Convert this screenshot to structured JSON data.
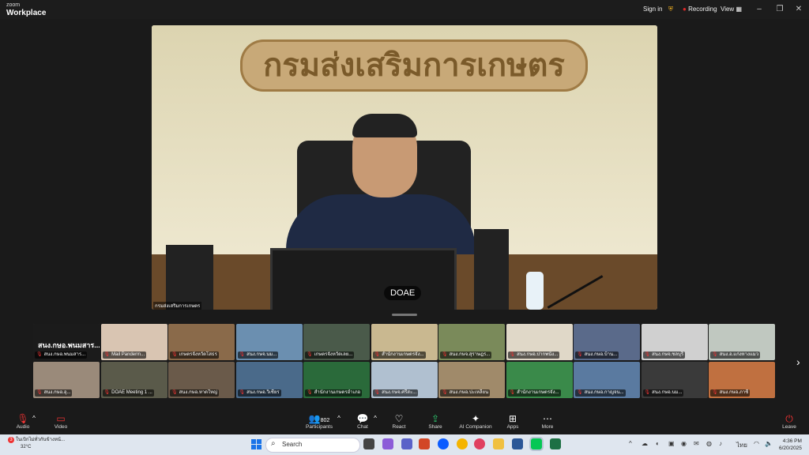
{
  "app": {
    "brand_small": "zoom",
    "brand_large": "Workplace"
  },
  "titlebar": {
    "sign_in": "Sign in",
    "recording": "Recording",
    "view": "View",
    "minimize": "–",
    "restore": "❐",
    "close": "✕"
  },
  "speaker": {
    "name_badge": "DOAE",
    "camera_label": "กรมส่งเสริมการเกษตร",
    "sign_text": "กรมส่งเสริมการเกษตร"
  },
  "gallery": {
    "tiles": [
      {
        "label": "สนง.กษอ.พนมสาร...",
        "bg": "#1b1b1b",
        "featured": true
      },
      {
        "label": "Mail Panderm...",
        "bg": "#d9c5b2"
      },
      {
        "label": "เกษตรจังหวัดโสธร",
        "bg": "#8a6a4a"
      },
      {
        "label": "สนง.กษจ.นม...",
        "bg": "#6b8fb0"
      },
      {
        "label": "เกษตรจังหวัดเลย...",
        "bg": "#4a5a4a"
      },
      {
        "label": "สำนักงานเกษตรจัง...",
        "bg": "#c9b890"
      },
      {
        "label": "สนง.กษจ.สุราษฎร...",
        "bg": "#7a8a5a"
      },
      {
        "label": "สนง.กษอ.ปากพนัง...",
        "bg": "#e0d8c8"
      },
      {
        "label": "สนง.กษอ.บ้าน...",
        "bg": "#5a6a8a"
      },
      {
        "label": "สนง.กษจ.ชลบุรี",
        "bg": "#d0d0d0"
      },
      {
        "label": "สนง.อ.แก่งหางแมว",
        "bg": "#c0c8c0"
      },
      {
        "label": "สนง.กษอ.อุ...",
        "bg": "#9a8a7a"
      },
      {
        "label": "DOAE Meeting 1 ...",
        "bg": "#5a5a4a"
      },
      {
        "label": "สนง.กษอ.หาดใหญ่",
        "bg": "#6a5a4a"
      },
      {
        "label": "สนง.กษอ.วิเชียร",
        "bg": "#4a6a8a"
      },
      {
        "label": "สำนักงานเกษตรอำเภอ",
        "bg": "#2a6a3a"
      },
      {
        "label": "สนง.กษจ.ศรีสะ...",
        "bg": "#b0c0d0"
      },
      {
        "label": "สนง.กษอ.ปะเหลียน",
        "bg": "#a08a6a"
      },
      {
        "label": "สำนักงานเกษตรจัง...",
        "bg": "#3a8a4a"
      },
      {
        "label": "สนง.กษอ.กาญจน...",
        "bg": "#5a7aa0"
      },
      {
        "label": "สนง.กษอ.นม...",
        "bg": "#3a3a3a"
      },
      {
        "label": "สนง.กษอ.ภาชี",
        "bg": "#c07040"
      }
    ],
    "next": "›"
  },
  "toolbar": {
    "audio": "Audio",
    "video": "Video",
    "participants_count": "802",
    "participants": "Participants",
    "chat": "Chat",
    "react": "React",
    "share": "Share",
    "ai_companion": "AI Companion",
    "apps": "Apps",
    "more": "More",
    "leave": "Leave"
  },
  "taskbar": {
    "weather_badge": "3",
    "weather_title": "ในเบิกไม่ทั่วกันข้างหน้...",
    "weather_temp": "32°C",
    "search": "Search",
    "language": "ไทย",
    "time": "4:36 PM",
    "date": "6/20/2025"
  },
  "colors": {
    "accent": "#0b5cff",
    "leave": "#e02828",
    "recording": "#e02828"
  }
}
